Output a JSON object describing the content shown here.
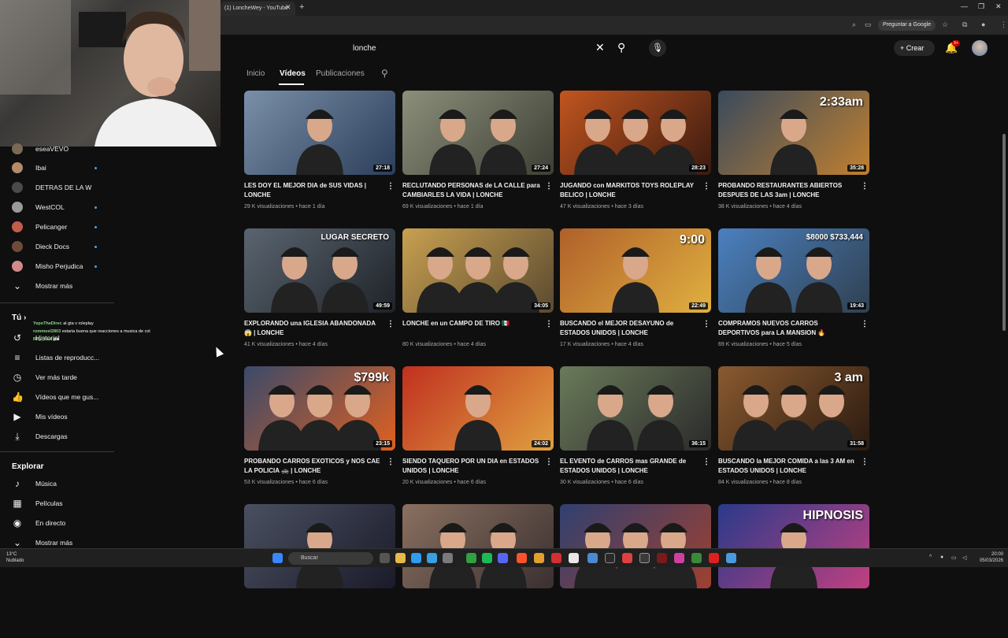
{
  "browser": {
    "tab_title": "(1) LoncheWey - YouTube",
    "ask_google": "Preguntar a Google"
  },
  "colors": {
    "background": "#0f0f0f",
    "accent": "#3ea6ff",
    "brand_red": "#ff0000"
  },
  "sidebar": {
    "channels": [
      {
        "label": "eseaVEVO",
        "avatar": "#7a6a55",
        "live": false
      },
      {
        "label": "Ibai",
        "avatar": "#b58a6b",
        "live": true
      },
      {
        "label": "DETRAS DE LA W",
        "avatar": "#4a4a4a",
        "live": false
      },
      {
        "label": "WestCOL",
        "avatar": "#9a9a9a",
        "live": true
      },
      {
        "label": "Pelicanger",
        "avatar": "#c25b4a",
        "live": true
      },
      {
        "label": "Dieck Docs",
        "avatar": "#6f4a3a",
        "live": true
      },
      {
        "label": "Misho Perjudica",
        "avatar": "#d08a8a",
        "live": true
      }
    ],
    "show_more": "Mostrar más",
    "you_label": "Tú",
    "you_items": [
      "Historial",
      "Listas de reproducc...",
      "Ver más tarde",
      "Vídeos que me gus...",
      "Mis vídeos",
      "Descargas"
    ],
    "explore_label": "Explorar",
    "explore_items": [
      "Música",
      "Películas",
      "En directo",
      "Mostrar más"
    ]
  },
  "chat": [
    {
      "user": "YepoTheDirec",
      "message": "al gta v roleplay"
    },
    {
      "user": "rommeel2803",
      "message": "estaria buena que reacciones a musica de col"
    },
    {
      "user": "Roy_free",
      "message": "gta"
    }
  ],
  "header": {
    "search_value": "lonche",
    "create_label": "Crear",
    "notification_count": "9+"
  },
  "channel_tabs": [
    "Inicio",
    "Vídeos",
    "Publicaciones"
  ],
  "videos": [
    {
      "title": "LES DOY EL MEJOR DIA de SUS VIDAS | LONCHE",
      "meta": "29 K visualizaciones • hace 1 día",
      "duration": "27:18",
      "bg": "linear-gradient(135deg,#7a8fa8,#2c3e5a)",
      "overlay": ""
    },
    {
      "title": "RECLUTANDO PERSONAS de LA CALLE para CAMBIARLES LA VIDA | LONCHE",
      "meta": "69 K visualizaciones • hace 1 día",
      "duration": "27:24",
      "bg": "linear-gradient(135deg,#8c8f7a,#3d3f35)",
      "overlay": ""
    },
    {
      "title": "JUGANDO con MARKITOS TOYS ROLEPLAY BELICO | LONCHE",
      "meta": "47 K visualizaciones • hace 3 días",
      "duration": "28:23",
      "bg": "linear-gradient(135deg,#c2551f,#3a1a10)",
      "overlay": ""
    },
    {
      "title": "PROBANDO RESTAURANTES ABIERTOS DESPUES DE LAS 3am | LONCHE",
      "meta": "38 K visualizaciones • hace 4 días",
      "duration": "35:28",
      "bg": "linear-gradient(135deg,#3a4a5c,#c08030)",
      "overlay": "2:33am"
    },
    {
      "title": "EXPLORANDO una IGLESIA ABANDONADA 😱 | LONCHE",
      "meta": "41 K visualizaciones • hace 4 días",
      "duration": "49:59",
      "bg": "linear-gradient(135deg,#5a6470,#1f2328)",
      "overlay": "LUGAR SECRETO"
    },
    {
      "title": "LONCHE en un CAMPO DE TIRO 🇲🇽",
      "meta": "80 K visualizaciones • hace 4 días",
      "duration": "34:05",
      "bg": "linear-gradient(135deg,#c8a050,#5a4a30)",
      "overlay": ""
    },
    {
      "title": "BUSCANDO el MEJOR DESAYUNO de ESTADOS UNIDOS | LONCHE",
      "meta": "17 K visualizaciones • hace 4 días",
      "duration": "22:49",
      "bg": "linear-gradient(135deg,#b0602a,#e0b040)",
      "overlay": "9:00"
    },
    {
      "title": "COMPRAMOS NUEVOS CARROS DEPORTIVOS para LA MANSION 🔥",
      "meta": "69 K visualizaciones • hace 5 días",
      "duration": "19:43",
      "bg": "linear-gradient(135deg,#4a80c0,#304050)",
      "overlay": "$8000 $733,444"
    },
    {
      "title": "PROBANDO CARROS EXOTICOS y NOS CAE LA POLICIA 🚓 | LONCHE",
      "meta": "53 K visualizaciones • hace 6 días",
      "duration": "23:15",
      "bg": "linear-gradient(135deg,#3a4a6a,#e06020)",
      "overlay": "$799k"
    },
    {
      "title": "SIENDO TAQUERO POR UN DIA en ESTADOS UNIDOS | LONCHE",
      "meta": "20 K visualizaciones • hace 6 días",
      "duration": "24:02",
      "bg": "linear-gradient(135deg,#c03020,#e0a040)",
      "overlay": ""
    },
    {
      "title": "EL EVENTO de CARROS mas GRANDE de ESTADOS UNIDOS | LONCHE",
      "meta": "30 K visualizaciones • hace 6 días",
      "duration": "36:15",
      "bg": "linear-gradient(135deg,#6a7a5a,#2a2a2a)",
      "overlay": ""
    },
    {
      "title": "BUSCANDO la MEJOR COMIDA a las 3 AM en ESTADOS UNIDOS | LONCHE",
      "meta": "84 K visualizaciones • hace 8 días",
      "duration": "31:58",
      "bg": "linear-gradient(135deg,#8a5a30,#2a1a10)",
      "overlay": "3 am"
    },
    {
      "title": "",
      "meta": "",
      "duration": "",
      "bg": "linear-gradient(135deg,#4a5060,#1a1a2a)",
      "overlay": ""
    },
    {
      "title": "",
      "meta": "",
      "duration": "",
      "bg": "linear-gradient(135deg,#8a7060,#3a3030)",
      "overlay": ""
    },
    {
      "title": "",
      "meta": "",
      "duration": "",
      "bg": "linear-gradient(135deg,#304070,#a04030)",
      "overlay": ""
    },
    {
      "title": "",
      "meta": "",
      "duration": "",
      "bg": "linear-gradient(135deg,#2a3a8a,#c04080)",
      "overlay": "HIPNOSIS"
    }
  ],
  "taskbar": {
    "search_label": "Buscar",
    "temperature": "13°C",
    "weather": "Nublado",
    "time": "20:00",
    "date": "05/03/2026"
  }
}
